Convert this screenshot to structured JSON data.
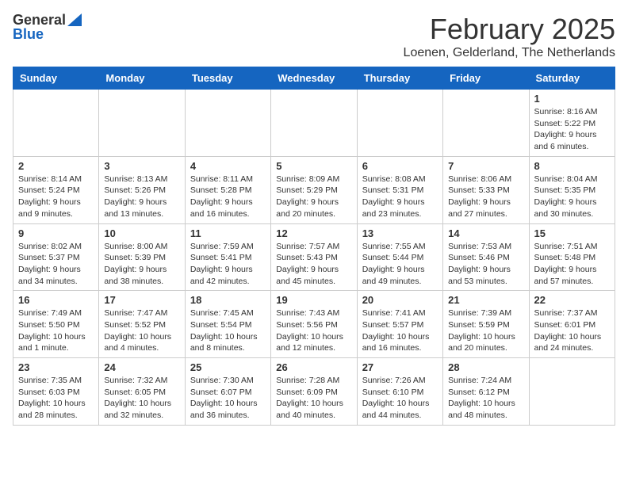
{
  "header": {
    "logo_general": "General",
    "logo_blue": "Blue",
    "month_title": "February 2025",
    "location": "Loenen, Gelderland, The Netherlands"
  },
  "days_of_week": [
    "Sunday",
    "Monday",
    "Tuesday",
    "Wednesday",
    "Thursday",
    "Friday",
    "Saturday"
  ],
  "weeks": [
    [
      {
        "day": "",
        "info": ""
      },
      {
        "day": "",
        "info": ""
      },
      {
        "day": "",
        "info": ""
      },
      {
        "day": "",
        "info": ""
      },
      {
        "day": "",
        "info": ""
      },
      {
        "day": "",
        "info": ""
      },
      {
        "day": "1",
        "info": "Sunrise: 8:16 AM\nSunset: 5:22 PM\nDaylight: 9 hours and 6 minutes."
      }
    ],
    [
      {
        "day": "2",
        "info": "Sunrise: 8:14 AM\nSunset: 5:24 PM\nDaylight: 9 hours and 9 minutes."
      },
      {
        "day": "3",
        "info": "Sunrise: 8:13 AM\nSunset: 5:26 PM\nDaylight: 9 hours and 13 minutes."
      },
      {
        "day": "4",
        "info": "Sunrise: 8:11 AM\nSunset: 5:28 PM\nDaylight: 9 hours and 16 minutes."
      },
      {
        "day": "5",
        "info": "Sunrise: 8:09 AM\nSunset: 5:29 PM\nDaylight: 9 hours and 20 minutes."
      },
      {
        "day": "6",
        "info": "Sunrise: 8:08 AM\nSunset: 5:31 PM\nDaylight: 9 hours and 23 minutes."
      },
      {
        "day": "7",
        "info": "Sunrise: 8:06 AM\nSunset: 5:33 PM\nDaylight: 9 hours and 27 minutes."
      },
      {
        "day": "8",
        "info": "Sunrise: 8:04 AM\nSunset: 5:35 PM\nDaylight: 9 hours and 30 minutes."
      }
    ],
    [
      {
        "day": "9",
        "info": "Sunrise: 8:02 AM\nSunset: 5:37 PM\nDaylight: 9 hours and 34 minutes."
      },
      {
        "day": "10",
        "info": "Sunrise: 8:00 AM\nSunset: 5:39 PM\nDaylight: 9 hours and 38 minutes."
      },
      {
        "day": "11",
        "info": "Sunrise: 7:59 AM\nSunset: 5:41 PM\nDaylight: 9 hours and 42 minutes."
      },
      {
        "day": "12",
        "info": "Sunrise: 7:57 AM\nSunset: 5:43 PM\nDaylight: 9 hours and 45 minutes."
      },
      {
        "day": "13",
        "info": "Sunrise: 7:55 AM\nSunset: 5:44 PM\nDaylight: 9 hours and 49 minutes."
      },
      {
        "day": "14",
        "info": "Sunrise: 7:53 AM\nSunset: 5:46 PM\nDaylight: 9 hours and 53 minutes."
      },
      {
        "day": "15",
        "info": "Sunrise: 7:51 AM\nSunset: 5:48 PM\nDaylight: 9 hours and 57 minutes."
      }
    ],
    [
      {
        "day": "16",
        "info": "Sunrise: 7:49 AM\nSunset: 5:50 PM\nDaylight: 10 hours and 1 minute."
      },
      {
        "day": "17",
        "info": "Sunrise: 7:47 AM\nSunset: 5:52 PM\nDaylight: 10 hours and 4 minutes."
      },
      {
        "day": "18",
        "info": "Sunrise: 7:45 AM\nSunset: 5:54 PM\nDaylight: 10 hours and 8 minutes."
      },
      {
        "day": "19",
        "info": "Sunrise: 7:43 AM\nSunset: 5:56 PM\nDaylight: 10 hours and 12 minutes."
      },
      {
        "day": "20",
        "info": "Sunrise: 7:41 AM\nSunset: 5:57 PM\nDaylight: 10 hours and 16 minutes."
      },
      {
        "day": "21",
        "info": "Sunrise: 7:39 AM\nSunset: 5:59 PM\nDaylight: 10 hours and 20 minutes."
      },
      {
        "day": "22",
        "info": "Sunrise: 7:37 AM\nSunset: 6:01 PM\nDaylight: 10 hours and 24 minutes."
      }
    ],
    [
      {
        "day": "23",
        "info": "Sunrise: 7:35 AM\nSunset: 6:03 PM\nDaylight: 10 hours and 28 minutes."
      },
      {
        "day": "24",
        "info": "Sunrise: 7:32 AM\nSunset: 6:05 PM\nDaylight: 10 hours and 32 minutes."
      },
      {
        "day": "25",
        "info": "Sunrise: 7:30 AM\nSunset: 6:07 PM\nDaylight: 10 hours and 36 minutes."
      },
      {
        "day": "26",
        "info": "Sunrise: 7:28 AM\nSunset: 6:09 PM\nDaylight: 10 hours and 40 minutes."
      },
      {
        "day": "27",
        "info": "Sunrise: 7:26 AM\nSunset: 6:10 PM\nDaylight: 10 hours and 44 minutes."
      },
      {
        "day": "28",
        "info": "Sunrise: 7:24 AM\nSunset: 6:12 PM\nDaylight: 10 hours and 48 minutes."
      },
      {
        "day": "",
        "info": ""
      }
    ]
  ]
}
